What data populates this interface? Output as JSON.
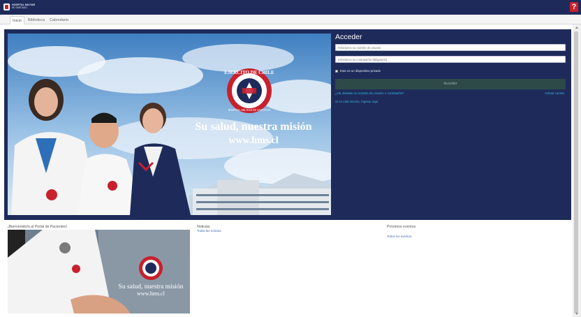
{
  "header": {
    "logo_line1": "HOSPITAL MILITAR",
    "logo_line2": "DE SANTIAGO",
    "help_label": "?"
  },
  "tabs": [
    {
      "label": "Inicio"
    },
    {
      "label": "Biblioteca"
    },
    {
      "label": "Calendario"
    }
  ],
  "banner": {
    "tagline": "Su salud, nuestra misión",
    "url": "www.hms.cl",
    "emblem_top": "EJERCITO DE CHILE",
    "emblem_bottom": "HOSPITAL MILITAR DE SANTIAGO"
  },
  "login": {
    "title": "Acceder",
    "username_placeholder": "Introduzca su nombre de usuario",
    "password_placeholder": "Introduzca su contraseña (obligatorio)",
    "remember_label": "Este es un dispositivo privado",
    "submit_label": "Acceder",
    "forgot_link": "¿Ha olvidado su nombre de usuario o contraseña?",
    "activate_link": "Activar cuenta",
    "register_link": "Si no está inscrito, Ingrese aquí"
  },
  "sections": {
    "welcome_title": "¡Bienvenido/a al Portal de Pacientes!",
    "news_title": "Noticias",
    "news_link": "Todas las noticias",
    "events_title": "Próximos eventos",
    "events_link": "Todos los eventos"
  },
  "promo": {
    "tagline": "Su salud, nuestra misión",
    "url": "www.hms.cl"
  },
  "colors": {
    "navy": "#1e2b5a",
    "accent_red": "#c8202d",
    "link_blue": "#38b6e3",
    "button_teal": "#2d4a49"
  }
}
